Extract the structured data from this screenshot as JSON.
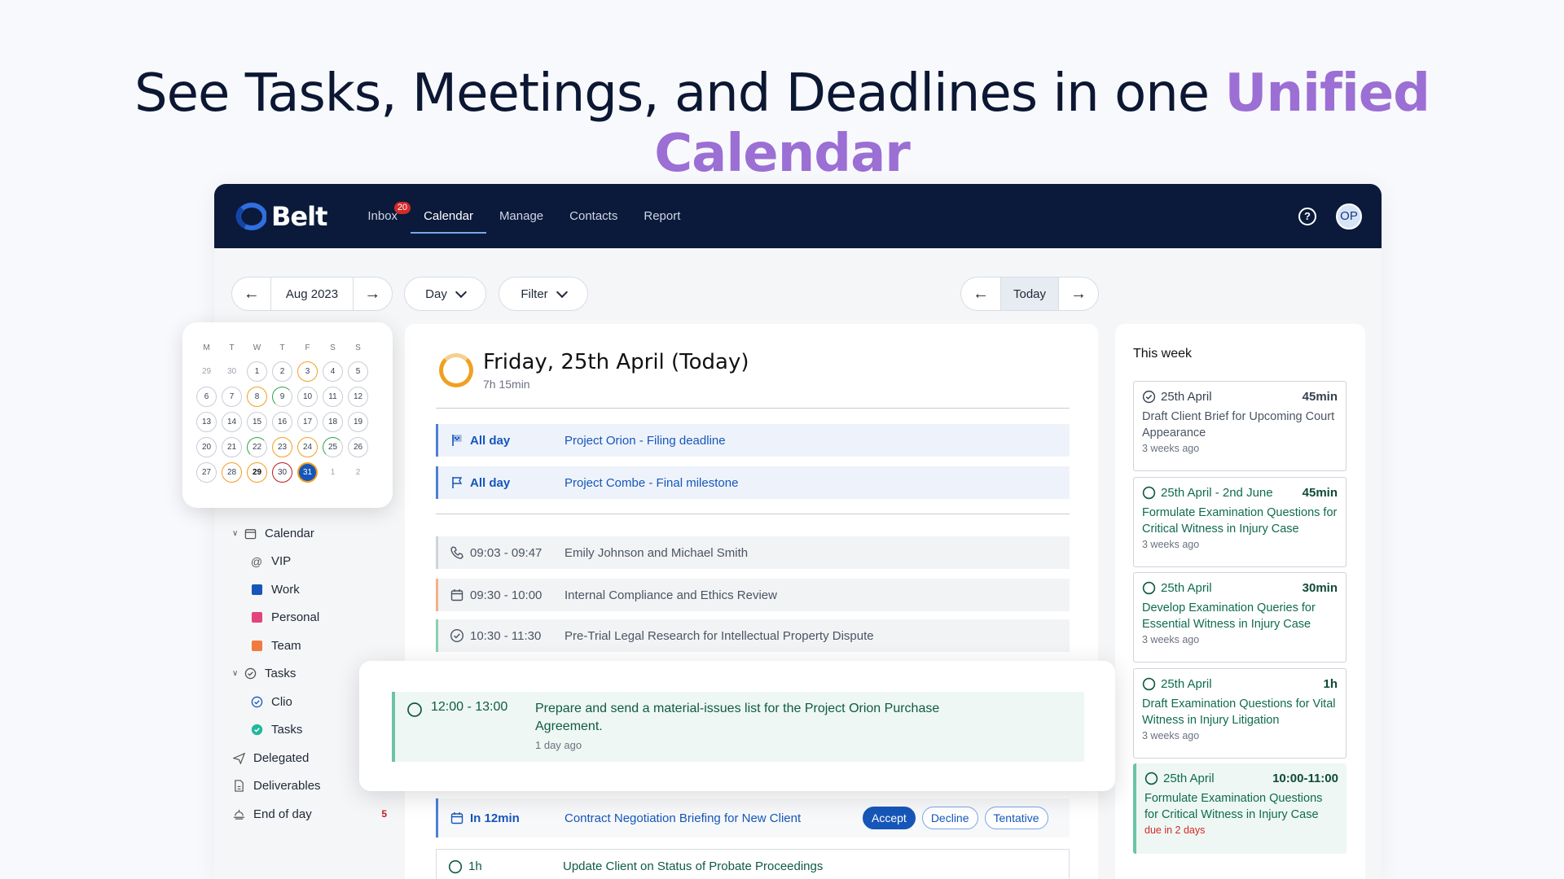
{
  "headline": {
    "lead": "See Tasks, Meetings, and Deadlines in one ",
    "accent": "Unified Calendar"
  },
  "app": {
    "logo": "Belt",
    "nav": [
      {
        "label": "Inbox",
        "badge": "20",
        "active": false
      },
      {
        "label": "Calendar",
        "active": true
      },
      {
        "label": "Manage",
        "active": false
      },
      {
        "label": "Contacts",
        "active": false
      },
      {
        "label": "Report",
        "active": false
      }
    ],
    "help_label": "?",
    "avatar": "OP"
  },
  "toolbar": {
    "month": "Aug 2023",
    "view": "Day",
    "filter": "Filter",
    "today": "Today",
    "prev_icon": "arrow-left-icon",
    "next_icon": "arrow-right-icon"
  },
  "mini_calendar": {
    "dow": [
      "M",
      "T",
      "W",
      "T",
      "F",
      "S",
      "S"
    ],
    "weeks": [
      [
        {
          "d": "29",
          "s": "muted"
        },
        {
          "d": "30",
          "s": "muted"
        },
        {
          "d": "1"
        },
        {
          "d": "2"
        },
        {
          "d": "3",
          "s": "orange"
        },
        {
          "d": "4"
        },
        {
          "d": "5"
        }
      ],
      [
        {
          "d": "6"
        },
        {
          "d": "7"
        },
        {
          "d": "8",
          "s": "orange"
        },
        {
          "d": "9",
          "s": "green"
        },
        {
          "d": "10"
        },
        {
          "d": "11"
        },
        {
          "d": "12"
        }
      ],
      [
        {
          "d": "13"
        },
        {
          "d": "14"
        },
        {
          "d": "15"
        },
        {
          "d": "16"
        },
        {
          "d": "17"
        },
        {
          "d": "18"
        },
        {
          "d": "19"
        }
      ],
      [
        {
          "d": "20"
        },
        {
          "d": "21"
        },
        {
          "d": "22",
          "s": "green"
        },
        {
          "d": "23",
          "s": "orange"
        },
        {
          "d": "24",
          "s": "orange"
        },
        {
          "d": "25",
          "s": "green"
        },
        {
          "d": "26"
        }
      ],
      [
        {
          "d": "27"
        },
        {
          "d": "28",
          "s": "orange"
        },
        {
          "d": "29",
          "s": "orange bold"
        },
        {
          "d": "30",
          "s": "red"
        },
        {
          "d": "31",
          "s": "sel"
        },
        {
          "d": "1",
          "s": "muted"
        },
        {
          "d": "2",
          "s": "muted"
        }
      ]
    ]
  },
  "sidebar": {
    "items": [
      {
        "label": "Calendar",
        "level": 1,
        "icon": "calendar-icon",
        "caret": true
      },
      {
        "label": "VIP",
        "level": 2,
        "icon": "at-icon"
      },
      {
        "label": "Work",
        "level": 2,
        "icon": "calendar-square-icon",
        "color": "#1656b8"
      },
      {
        "label": "Personal",
        "level": 2,
        "icon": "calendar-square-icon",
        "color": "#e0457b"
      },
      {
        "label": "Team",
        "level": 2,
        "icon": "calendar-square-icon",
        "color": "#f07b3f"
      },
      {
        "label": "Tasks",
        "level": 1,
        "icon": "check-circle-icon",
        "caret": true
      },
      {
        "label": "Clio",
        "level": 2,
        "icon": "check-circle-icon",
        "color": "#1656b8"
      },
      {
        "label": "Tasks",
        "level": 2,
        "icon": "check-filled-icon",
        "color": "#22b89a"
      },
      {
        "label": "Delegated",
        "level": 0,
        "icon": "send-icon"
      },
      {
        "label": "Deliverables",
        "level": 0,
        "icon": "document-icon"
      },
      {
        "label": "End of day",
        "level": 0,
        "icon": "sunset-icon",
        "count": "5"
      }
    ]
  },
  "day": {
    "title": "Friday, 25th April (Today)",
    "total": "7h 15min",
    "all_day": [
      {
        "time": "All day",
        "title": "Project Orion - Filing deadline",
        "icon": "flag-filled-icon"
      },
      {
        "time": "All day",
        "title": "Project Combe - Final milestone",
        "icon": "flag-outline-icon"
      }
    ],
    "events": [
      {
        "time": "09:03 - 09:47",
        "title": "Emily Johnson and Michael Smith",
        "icon": "phone-icon"
      },
      {
        "time": "09:30 - 10:00",
        "title": "Internal Compliance and Ethics Review",
        "icon": "calendar-icon"
      },
      {
        "time": "10:30 - 11:30",
        "title": "Pre-Trial Legal Research for Intellectual Property Dispute",
        "icon": "check-circle-icon"
      }
    ],
    "focus": {
      "time": "12:00 - 13:00",
      "title": "Prepare and send a material-issues list for the Project Orion Purchase Agreement.",
      "meta": "1 day ago"
    },
    "invite": {
      "time": "In 12min",
      "title": "Contract Negotiation Briefing for New Client",
      "accept": "Accept",
      "decline": "Decline",
      "tentative": "Tentative"
    },
    "task": {
      "time": "1h",
      "title": "Update Client on Status of Probate Proceedings"
    }
  },
  "week": {
    "title": "This week",
    "items": [
      {
        "date": "25th April",
        "dur": "45min",
        "title": "Draft Client Brief for Upcoming Court Appearance",
        "meta": "3 weeks ago",
        "style": "gray"
      },
      {
        "date": "25th April - 2nd June",
        "dur": "45min",
        "title": "Formulate Examination Questions for Critical Witness in Injury Case",
        "meta": "3 weeks ago",
        "style": "green"
      },
      {
        "date": "25th April",
        "dur": "30min",
        "title": "Develop Examination Queries for Essential Witness in Injury Case",
        "meta": "3 weeks ago",
        "style": "green"
      },
      {
        "date": "25th April",
        "dur": "1h",
        "title": "Draft Examination Questions for Vital Witness in Injury Litigation",
        "meta": "3 weeks ago",
        "style": "green"
      },
      {
        "date": "25th April",
        "dur": "10:00-11:00",
        "title": "Formulate Examination Questions for Critical Witness in Injury Case",
        "meta": "due in 2 days",
        "style": "green hl"
      }
    ]
  }
}
